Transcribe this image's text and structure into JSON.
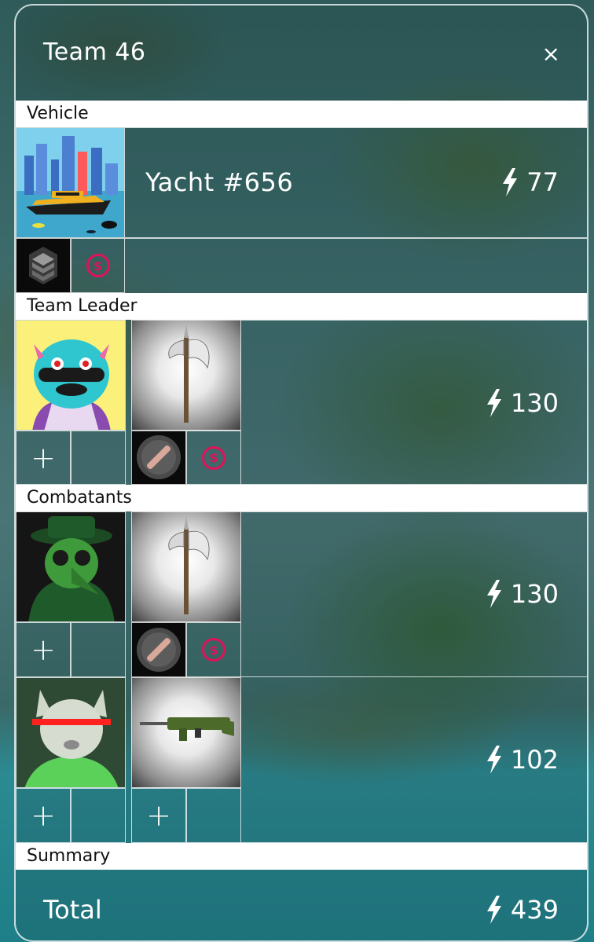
{
  "header": {
    "title": "Team 46",
    "close_glyph": "×"
  },
  "sections": {
    "vehicle": "Vehicle",
    "team_leader": "Team Leader",
    "combatants": "Combatants",
    "summary": "Summary"
  },
  "vehicle": {
    "name": "Yacht #656",
    "power": "77",
    "image": "yacht-image",
    "slot_icon": "stone-stack-icon",
    "currency_icon": "dollar-coin-icon"
  },
  "team_leader": {
    "power": "130",
    "avatar": "blue-monster-avatar",
    "weapon": "battle-axe",
    "add_glyph": "+"
  },
  "combatants": [
    {
      "power": "130",
      "avatar": "green-plague-doctor-avatar",
      "weapon": "battle-axe",
      "add_glyph": "+"
    },
    {
      "power": "102",
      "avatar": "cat-laser-eyes-avatar",
      "weapon": "green-assault-rifle",
      "add_glyph": "+"
    }
  ],
  "summary": {
    "total_label": "Total",
    "total_power": "439"
  },
  "colors": {
    "accent_pink": "#e0125a",
    "text": "#ffffff"
  }
}
